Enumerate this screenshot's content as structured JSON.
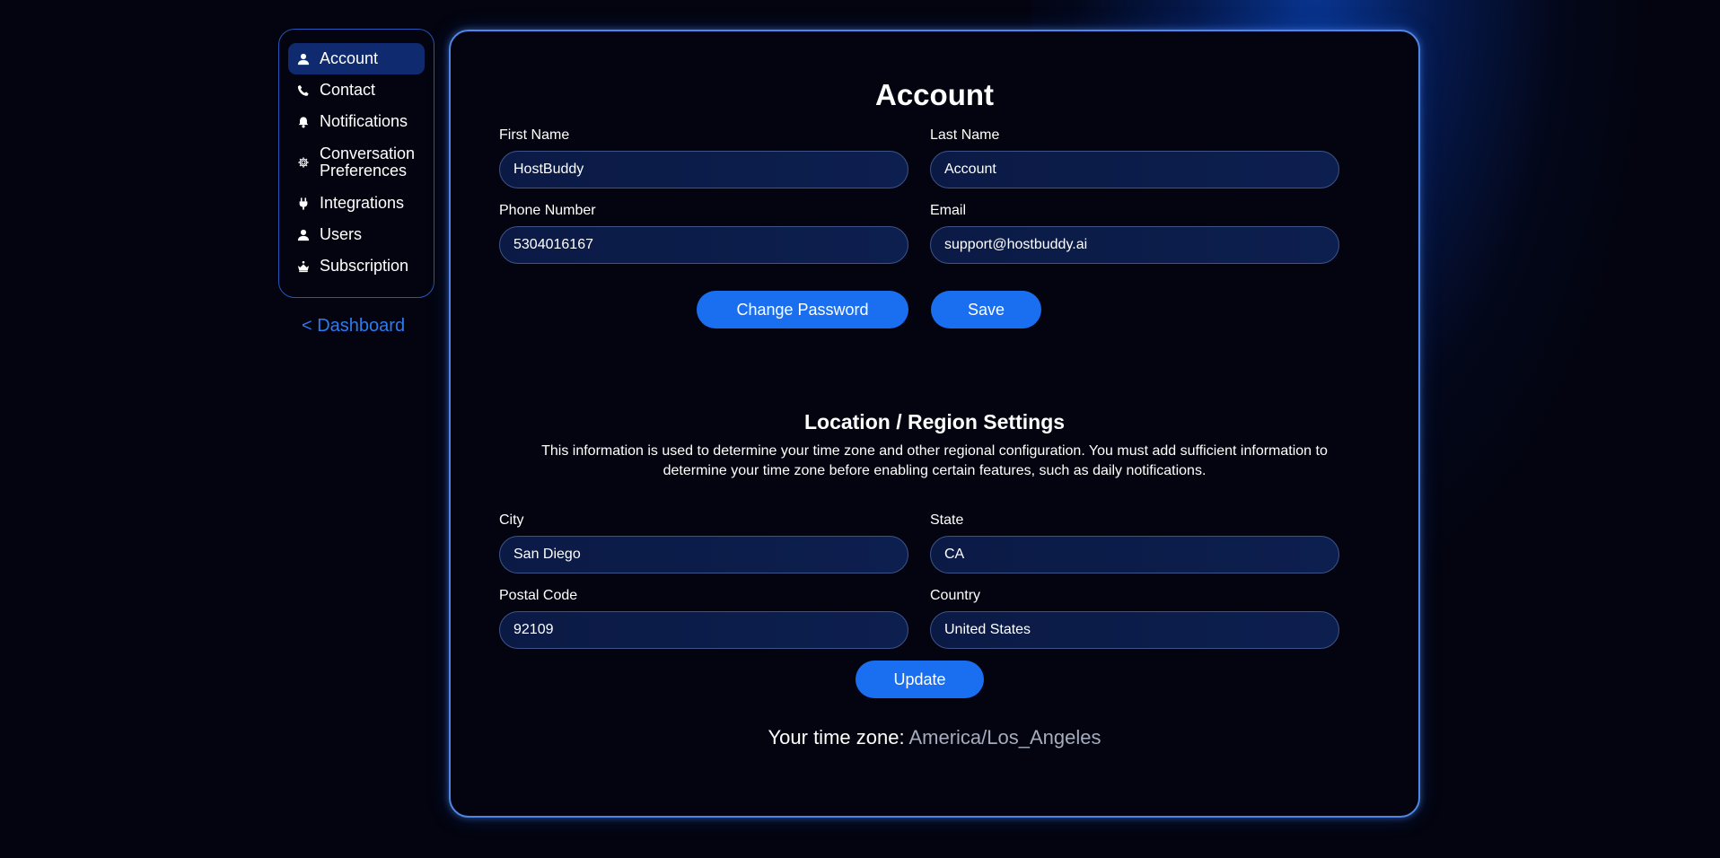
{
  "colors": {
    "accent": "#1a6ff0",
    "link": "#2c7bf0",
    "background": "#03040f",
    "input_bg": "#0c1d4a",
    "card_border": "#4f86e6",
    "active_nav": "#0f2a6e",
    "muted_text": "#a5acbd"
  },
  "sidebar": {
    "items": [
      {
        "label": "Account",
        "icon": "user-icon",
        "active": true
      },
      {
        "label": "Contact",
        "icon": "phone-icon",
        "active": false
      },
      {
        "label": "Notifications",
        "icon": "bell-icon",
        "active": false
      },
      {
        "label": "Conversation Preferences",
        "icon": "gear-icon",
        "active": false
      },
      {
        "label": "Integrations",
        "icon": "plug-icon",
        "active": false
      },
      {
        "label": "Users",
        "icon": "user-icon",
        "active": false
      },
      {
        "label": "Subscription",
        "icon": "crown-icon",
        "active": false
      }
    ],
    "back_link": "< Dashboard"
  },
  "account": {
    "title": "Account",
    "fields": {
      "first_name": {
        "label": "First Name",
        "value": "HostBuddy"
      },
      "last_name": {
        "label": "Last Name",
        "value": "Account"
      },
      "phone": {
        "label": "Phone Number",
        "value": "5304016167"
      },
      "email": {
        "label": "Email",
        "value": "support@hostbuddy.ai"
      }
    },
    "change_password_label": "Change Password",
    "save_label": "Save"
  },
  "location": {
    "title": "Location / Region Settings",
    "description": "This information is used to determine your time zone and other regional configuration. You must add sufficient information to determine your time zone before enabling certain features, such as daily notifications.",
    "fields": {
      "city": {
        "label": "City",
        "value": "San Diego"
      },
      "state": {
        "label": "State",
        "value": "CA"
      },
      "postal_code": {
        "label": "Postal Code",
        "value": "92109"
      },
      "country": {
        "label": "Country",
        "value": "United States"
      }
    },
    "update_label": "Update",
    "timezone_label": "Your time zone:",
    "timezone_value": "America/Los_Angeles"
  }
}
